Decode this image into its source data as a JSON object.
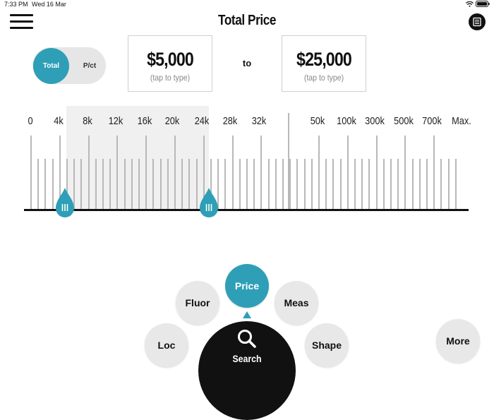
{
  "status_bar": {
    "time": "7:33 PM",
    "date": "Wed 16 Mar",
    "battery": "100%"
  },
  "header": {
    "title": "Total Price"
  },
  "toggle": {
    "on_label": "Total",
    "off_label": "P/ct"
  },
  "price_range": {
    "min": {
      "value": "$5,000",
      "hint": "(tap to type)"
    },
    "separator": "to",
    "max": {
      "value": "$25,000",
      "hint": "(tap to type)"
    }
  },
  "slider": {
    "tick_labels": [
      "0",
      "4k",
      "8k",
      "12k",
      "16k",
      "20k",
      "24k",
      "28k",
      "32k",
      "50k",
      "100k",
      "300k",
      "500k",
      "700k",
      "Max."
    ],
    "handle_min_label": "5k",
    "handle_max_label": "25k",
    "handle_grip": "III"
  },
  "nav": {
    "loc": "Loc",
    "fluor": "Fluor",
    "price": "Price",
    "meas": "Meas",
    "shape": "Shape",
    "search": "Search",
    "more": "More"
  },
  "colors": {
    "accent": "#2e9fb7",
    "dark": "#111111",
    "light_gray": "#e8e8e8"
  },
  "icons": {
    "menu": "hamburger-icon",
    "list": "list-icon",
    "search": "search-icon",
    "pointer": "caret-up-icon"
  }
}
